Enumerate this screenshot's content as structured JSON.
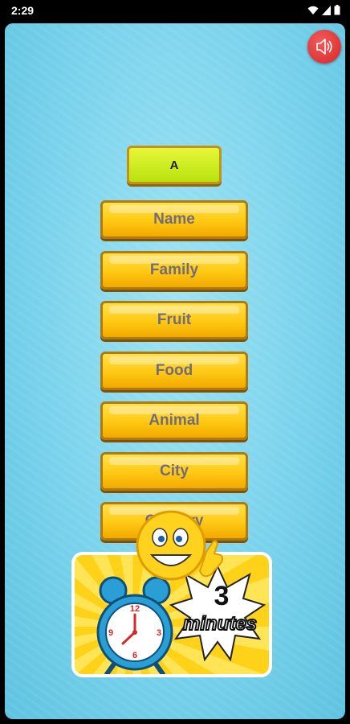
{
  "status_bar": {
    "time": "2:29"
  },
  "sound_button": {
    "icon": "speaker-icon"
  },
  "letter": {
    "value": "A"
  },
  "categories": [
    {
      "label": "Name"
    },
    {
      "label": "Family"
    },
    {
      "label": "Fruit"
    },
    {
      "label": "Food"
    },
    {
      "label": "Animal"
    },
    {
      "label": "City"
    },
    {
      "label": "Country"
    }
  ],
  "promo": {
    "number": "3",
    "unit": "minutes"
  },
  "colors": {
    "background": "#7ad3ec",
    "button": "#ffc812",
    "letter_button": "#d4ee1e",
    "sound": "#e23b3b"
  }
}
